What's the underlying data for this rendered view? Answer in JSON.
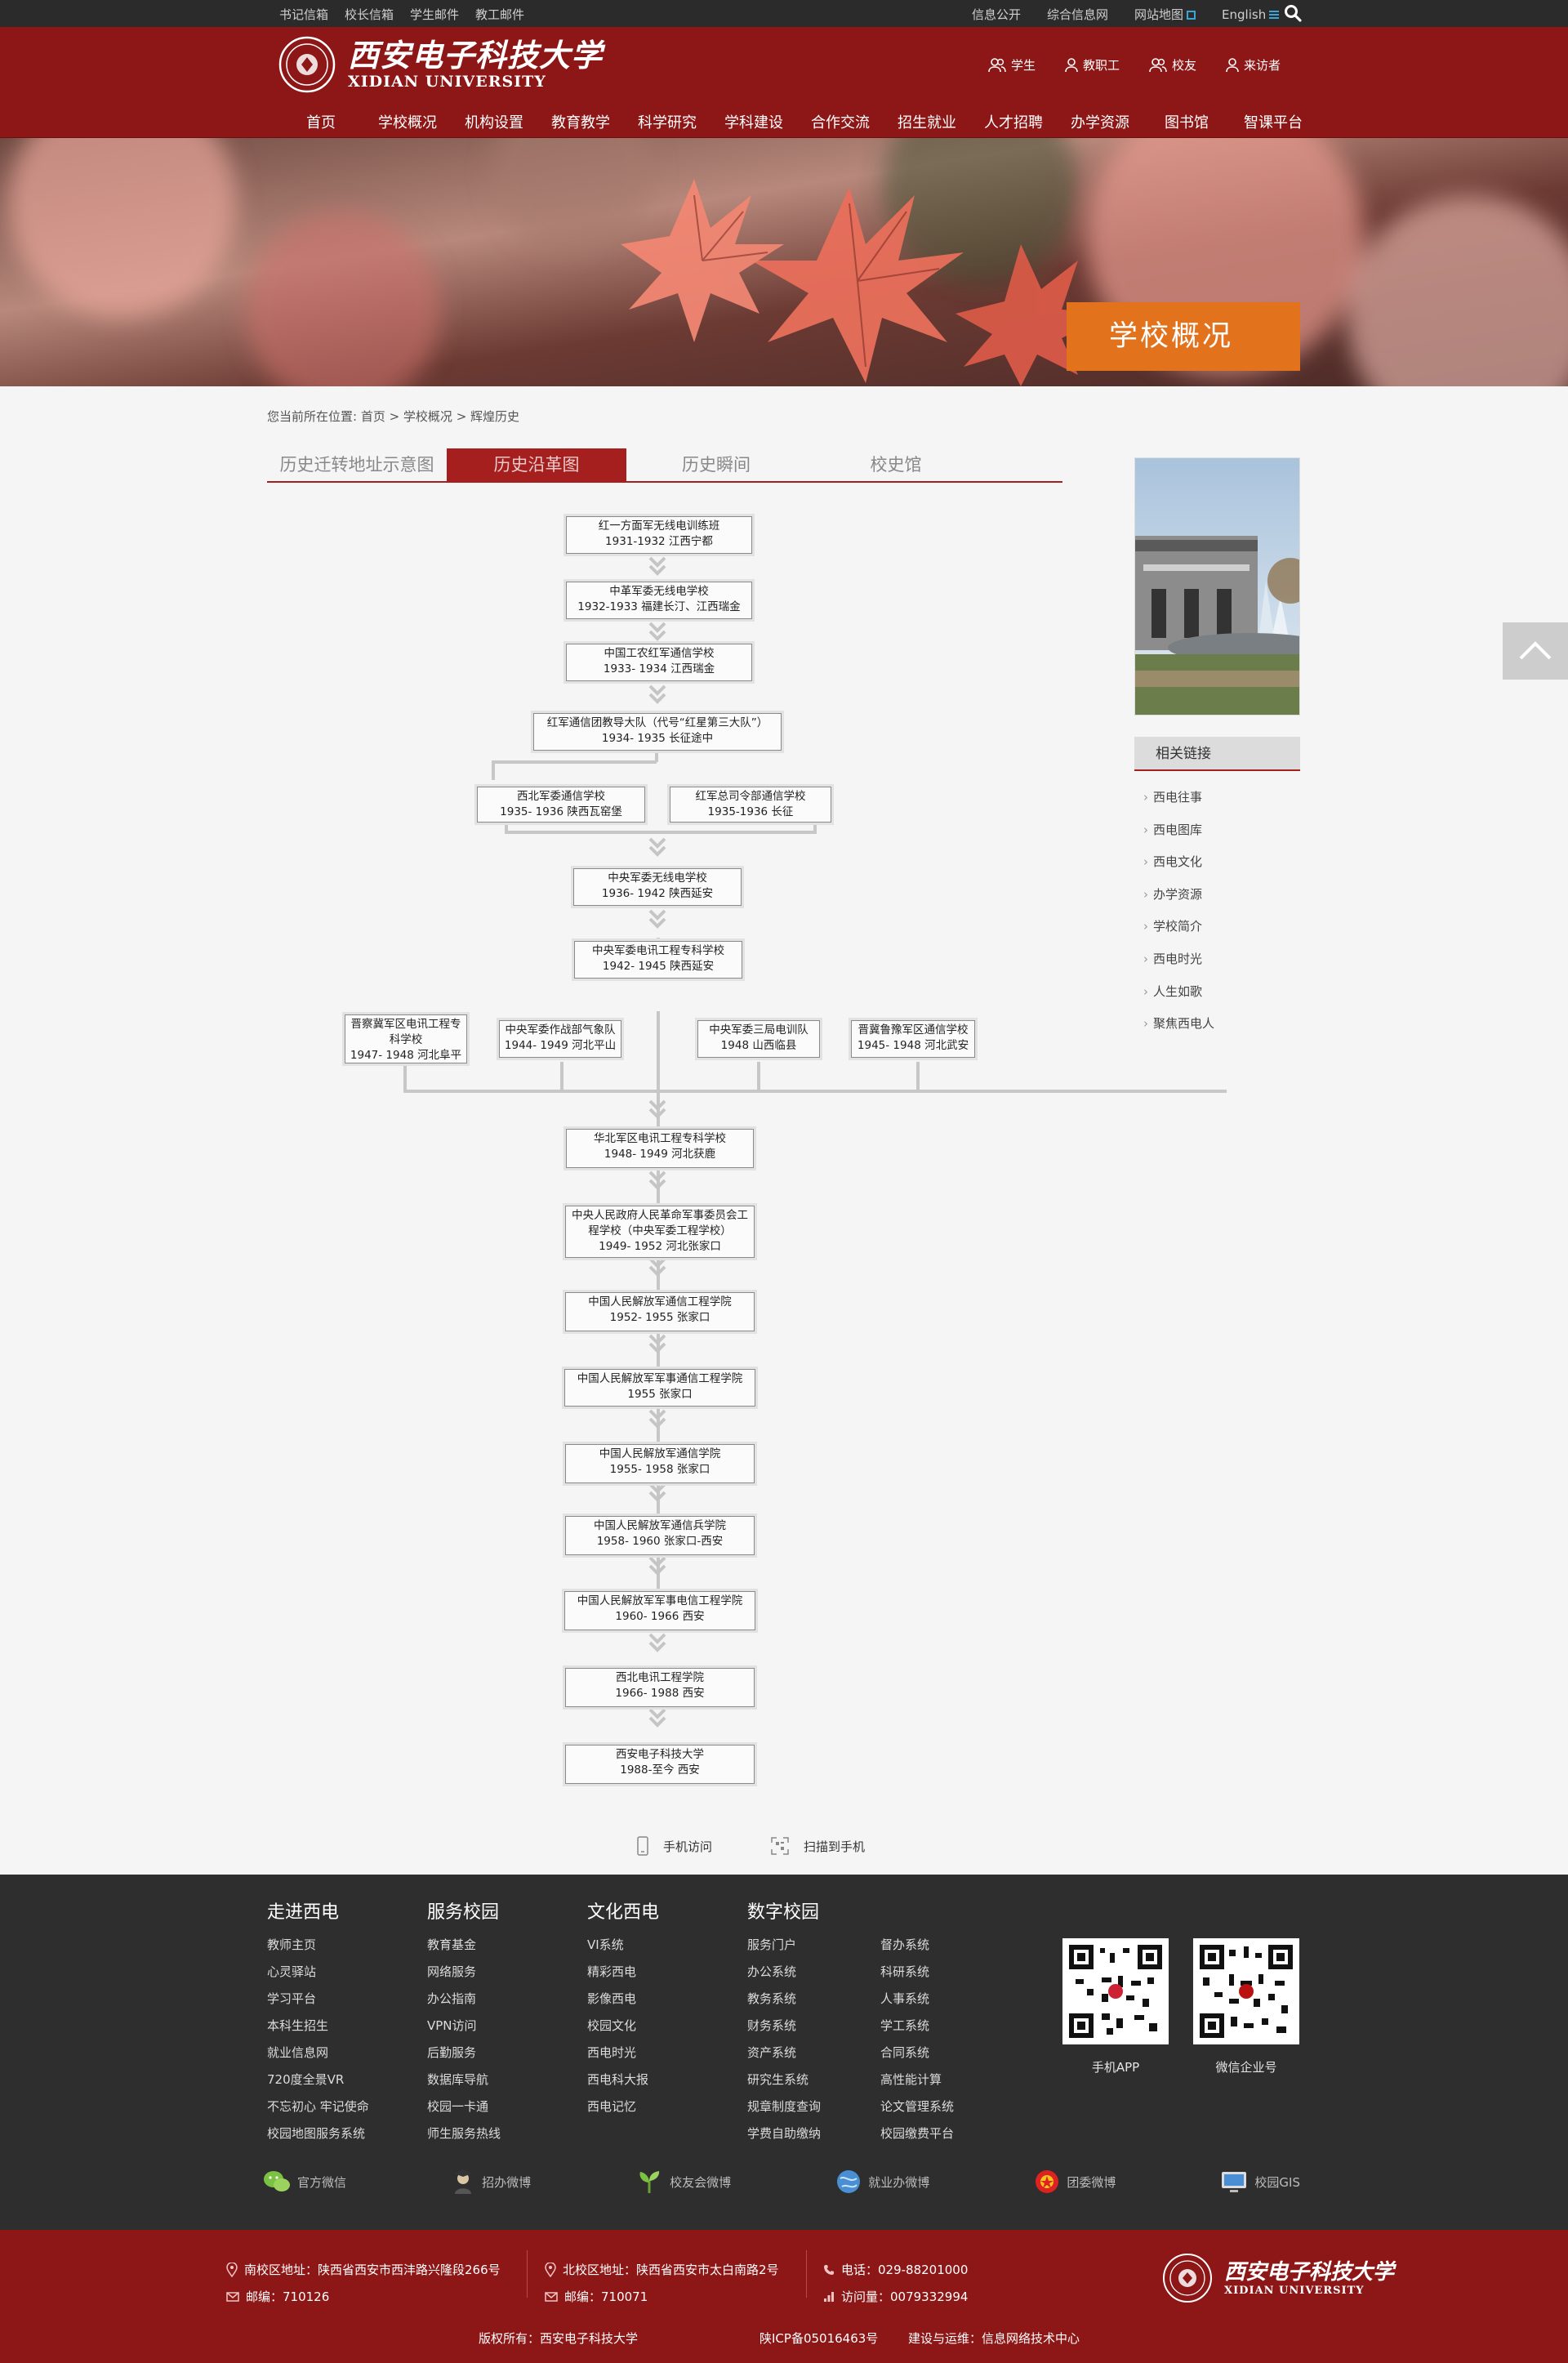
{
  "topbar": {
    "left_links": [
      "书记信箱",
      "校长信箱",
      "学生邮件",
      "教工邮件"
    ],
    "right_links": [
      "信息公开",
      "综合信息网",
      "网站地图",
      "English"
    ]
  },
  "header": {
    "logo_cn": "西安电子科技大学",
    "logo_en": "XIDIAN UNIVERSITY",
    "quick_links": [
      "学生",
      "教职工",
      "校友",
      "来访者"
    ],
    "nav": [
      "首页",
      "学校概况",
      "机构设置",
      "教育教学",
      "科学研究",
      "学科建设",
      "合作交流",
      "招生就业",
      "人才招聘",
      "办学资源",
      "图书馆",
      "智课平台"
    ]
  },
  "banner": {
    "title": "学校概况"
  },
  "breadcrumb": "您当前所在位置: 首页 > 学校概况 > 辉煌历史",
  "tabs": [
    {
      "label": "历史迁转地址示意图",
      "active": false
    },
    {
      "label": "历史沿革图",
      "active": true
    },
    {
      "label": "历史瞬间",
      "active": false
    },
    {
      "label": "校史馆",
      "active": false
    }
  ],
  "history": [
    {
      "name": "红一方面军无线电训练班",
      "period": "1931-1932 江西宁都"
    },
    {
      "name": "中革军委无线电学校",
      "period": "1932-1933 福建长汀、江西瑞金"
    },
    {
      "name": "中国工农红军通信学校",
      "period": "1933- 1934 江西瑞金"
    },
    {
      "name": "红军通信团教导大队（代号“红星第三大队”）",
      "period": "1934- 1935 长征途中"
    },
    {
      "name": "西北军委通信学校",
      "period": "1935- 1936 陕西瓦窑堡"
    },
    {
      "name": "红军总司令部通信学校",
      "period": "1935-1936 长征"
    },
    {
      "name": "中央军委无线电学校",
      "period": "1936- 1942 陕西延安"
    },
    {
      "name": "中央军委电讯工程专科学校",
      "period": "1942- 1945 陕西延安"
    },
    {
      "name": "晋察冀军区电讯工程专科学校",
      "period": "1947- 1948 河北阜平"
    },
    {
      "name": "中央军委作战部气象队",
      "period": "1944- 1949 河北平山"
    },
    {
      "name": "中央军委三局电训队",
      "period": "1948 山西临县"
    },
    {
      "name": "晋冀鲁豫军区通信学校",
      "period": "1945- 1948 河北武安"
    },
    {
      "name": "华北军区电讯工程专科学校",
      "period": "1948- 1949 河北获鹿"
    },
    {
      "name": "中央人民政府人民革命军事委员会工程学校（中央军委工程学校）",
      "period": "1949- 1952 河北张家口"
    },
    {
      "name": "中国人民解放军通信工程学院",
      "period": "1952- 1955 张家口"
    },
    {
      "name": "中国人民解放军军事通信工程学院",
      "period": "1955 张家口"
    },
    {
      "name": "中国人民解放军通信学院",
      "period": "1955- 1958 张家口"
    },
    {
      "name": "中国人民解放军通信兵学院",
      "period": "1958- 1960 张家口-西安"
    },
    {
      "name": "中国人民解放军军事电信工程学院",
      "period": "1960- 1966 西安"
    },
    {
      "name": "西北电讯工程学院",
      "period": "1966- 1988 西安"
    },
    {
      "name": "西安电子科技大学",
      "period": "1988-至今 西安"
    }
  ],
  "sidebar": {
    "head": "相关链接",
    "links": [
      "西电往事",
      "西电图库",
      "西电文化",
      "办学资源",
      "学校简介",
      "西电时光",
      "人生如歌",
      "聚焦西电人"
    ]
  },
  "mobile": {
    "visit": "手机访问",
    "scan": "扫描到手机"
  },
  "footer": {
    "columns": [
      {
        "title": "走进西电",
        "links": [
          "教师主页",
          "心灵驿站",
          "学习平台",
          "本科生招生",
          "就业信息网",
          "720度全景VR",
          "不忘初心 牢记使命",
          "校园地图服务系统"
        ]
      },
      {
        "title": "服务校园",
        "links": [
          "教育基金",
          "网络服务",
          "办公指南",
          "VPN访问",
          "后勤服务",
          "数据库导航",
          "校园一卡通",
          "师生服务热线"
        ]
      },
      {
        "title": "文化西电",
        "links": [
          "VI系统",
          "精彩西电",
          "影像西电",
          "校园文化",
          "西电时光",
          "西电科大报",
          "西电记忆"
        ]
      },
      {
        "title": "数字校园",
        "links": [
          "服务门户",
          "办公系统",
          "教务系统",
          "财务系统",
          "资产系统",
          "研究生系统",
          "规章制度查询",
          "学费自助缴纳"
        ]
      },
      {
        "title": "",
        "links": [
          "督办系统",
          "科研系统",
          "人事系统",
          "学工系统",
          "合同系统",
          "高性能计算",
          "论文管理系统",
          "校园缴费平台"
        ]
      }
    ],
    "qr": [
      "手机APP",
      "微信企业号"
    ],
    "social": [
      "官方微信",
      "招办微博",
      "校友会微博",
      "就业办微博",
      "团委微博",
      "校园GIS"
    ]
  },
  "bottom": {
    "south_address": "南校区地址：陕西省西安市西沣路兴隆段266号",
    "south_zip": "邮编：710126",
    "north_address": "北校区地址：陕西省西安市太白南路2号",
    "north_zip": "邮编：710071",
    "phone": "电话：029-88201000",
    "visits": "访问量：0079332994",
    "copyright": "版权所有：西安电子科技大学",
    "icp": "陕ICP备05016463号",
    "ops": "建设与运维：信息网络技术中心",
    "logo_cn": "西安电子科技大学",
    "logo_en": "XIDIAN UNIVERSITY"
  },
  "colors": {
    "brand_red": "#8d1616",
    "tab_red": "#a51f1f",
    "banner_orange": "#e3721d",
    "footer_dark": "#2e2e2e"
  }
}
